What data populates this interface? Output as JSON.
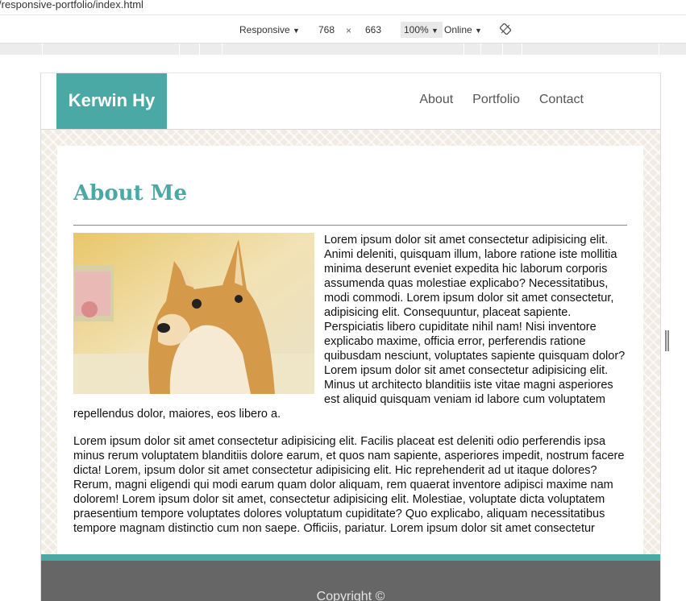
{
  "browser": {
    "url": "/responsive-portfolio/index.html",
    "device_mode": "Responsive",
    "width_value": "768",
    "times": "×",
    "height_value": "663",
    "zoom": "100%",
    "throttle": "Online"
  },
  "site": {
    "logo": "Kerwin Hy",
    "nav": [
      {
        "label": "About"
      },
      {
        "label": "Portfolio"
      },
      {
        "label": "Contact"
      }
    ],
    "heading": "About Me",
    "paragraphs": [
      "Lorem ipsum dolor sit amet consectetur adipisicing elit. Animi deleniti, quisquam illum, labore ratione iste mollitia minima deserunt eveniet expedita hic laborum corporis assumenda quas molestiae explicabo? Necessitatibus, modi commodi. Lorem ipsum dolor sit amet consectetur, adipisicing elit. Consequuntur, placeat sapiente. Perspiciatis libero cupiditate nihil nam! Nisi inventore explicabo maxime, officia error, perferendis ratione quibusdam nesciunt, voluptates sapiente quisquam dolor? Lorem ipsum dolor sit amet consectetur adipisicing elit. Minus ut architecto blanditiis iste vitae magni asperiores est aliquid quisquam veniam id labore cum voluptatem repellendus dolor, maiores, eos libero a.",
      "Lorem ipsum dolor sit amet consectetur adipisicing elit. Facilis placeat est deleniti odio perferendis ipsa minus rerum voluptatem blanditiis dolore earum, et quos nam sapiente, asperiores impedit, nostrum facere dicta! Lorem, ipsum dolor sit amet consectetur adipisicing elit. Hic reprehenderit ad ut itaque dolores? Rerum, magni eligendi qui modi earum quam dolor aliquam, rem quaerat inventore adipisci maxime nam dolorem! Lorem ipsum dolor sit amet, consectetur adipisicing elit. Molestiae, voluptate dicta voluptatem praesentium tempore voluptates dolores voluptatum cupiditate? Quo explicabo, aliquam necessitatibus tempore magnam distinctio cum non saepe. Officiis, pariatur. Lorem ipsum dolor sit amet consectetur"
    ],
    "footer": "Copyright ©"
  },
  "colors": {
    "accent": "#4aa8a5",
    "footer_bg": "#666666"
  },
  "icons": [
    "dropdown-arrow-icon",
    "rotate-icon",
    "resize-handle-icon",
    "doge-image"
  ]
}
